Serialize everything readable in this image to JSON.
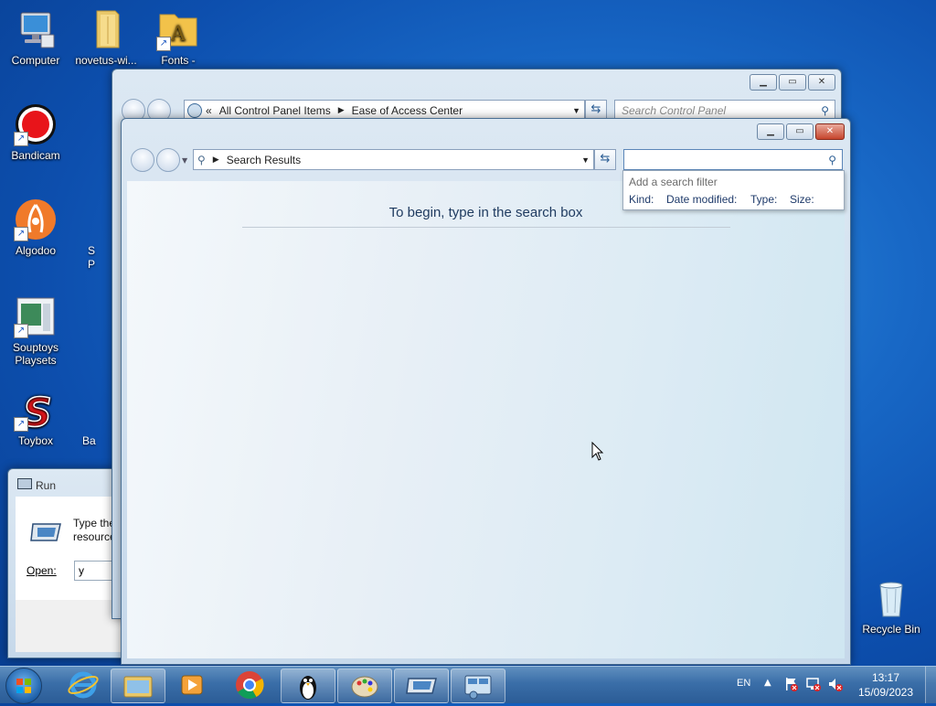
{
  "desktop": {
    "icons": [
      {
        "label": "Computer"
      },
      {
        "label": "novetus-wi..."
      },
      {
        "label": "Fonts -"
      },
      {
        "label": "Bandicam"
      },
      {
        "label": "Algodoo"
      },
      {
        "label": "Souptoys Playsets"
      },
      {
        "label": "Toybox"
      },
      {
        "label": "Recycle Bin"
      }
    ],
    "partial_labels": [
      "S",
      "P",
      "Ba"
    ]
  },
  "run_dialog": {
    "title": "Run",
    "description": "Type the\nresource",
    "open_label": "Open:",
    "open_value": "y"
  },
  "control_panel_window": {
    "breadcrumb_chevrons": "«",
    "breadcrumb": [
      "All Control Panel Items",
      "Ease of Access Center"
    ],
    "search_placeholder": "Search Control Panel"
  },
  "search_window": {
    "address": "Search Results",
    "search_value": "",
    "message": "To begin, type in the search box",
    "filter_popup": {
      "title": "Add a search filter",
      "filters": [
        "Kind:",
        "Date modified:",
        "Type:",
        "Size:"
      ]
    }
  },
  "taskbar": {
    "language": "EN",
    "time": "13:17",
    "date": "15/09/2023",
    "buttons": [
      {
        "name": "internet-explorer"
      },
      {
        "name": "windows-explorer"
      },
      {
        "name": "media-player"
      },
      {
        "name": "chrome"
      },
      {
        "name": "tux-app"
      },
      {
        "name": "paint"
      },
      {
        "name": "run"
      },
      {
        "name": "control-panel"
      }
    ]
  },
  "colors": {
    "accent": "#1868c6",
    "taskbar": "#3a6ea8",
    "heading_text": "#1e3a5f"
  }
}
